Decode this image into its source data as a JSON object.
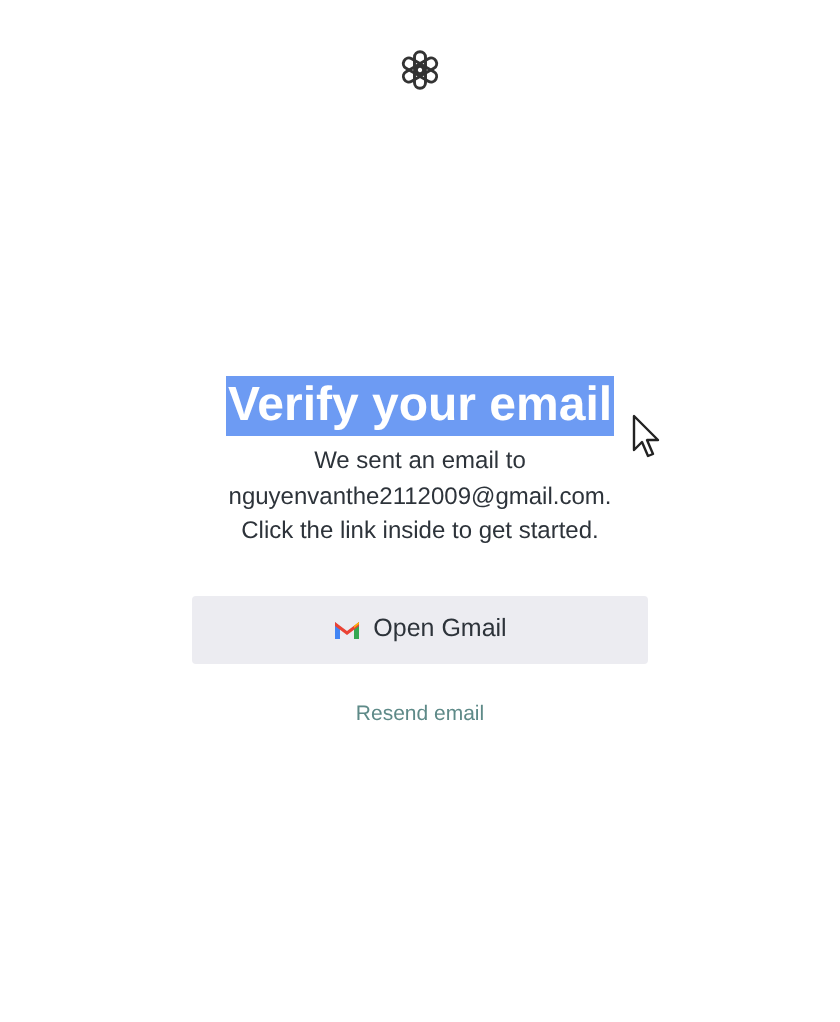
{
  "heading": {
    "text": "Verify your email",
    "selected": true
  },
  "message": [
    "We sent an email to",
    "nguyenvanthe2112009@gmail.com.",
    "Click the link inside to get started."
  ],
  "primary_button": {
    "label": "Open Gmail"
  },
  "link": {
    "label": "Resend email"
  }
}
